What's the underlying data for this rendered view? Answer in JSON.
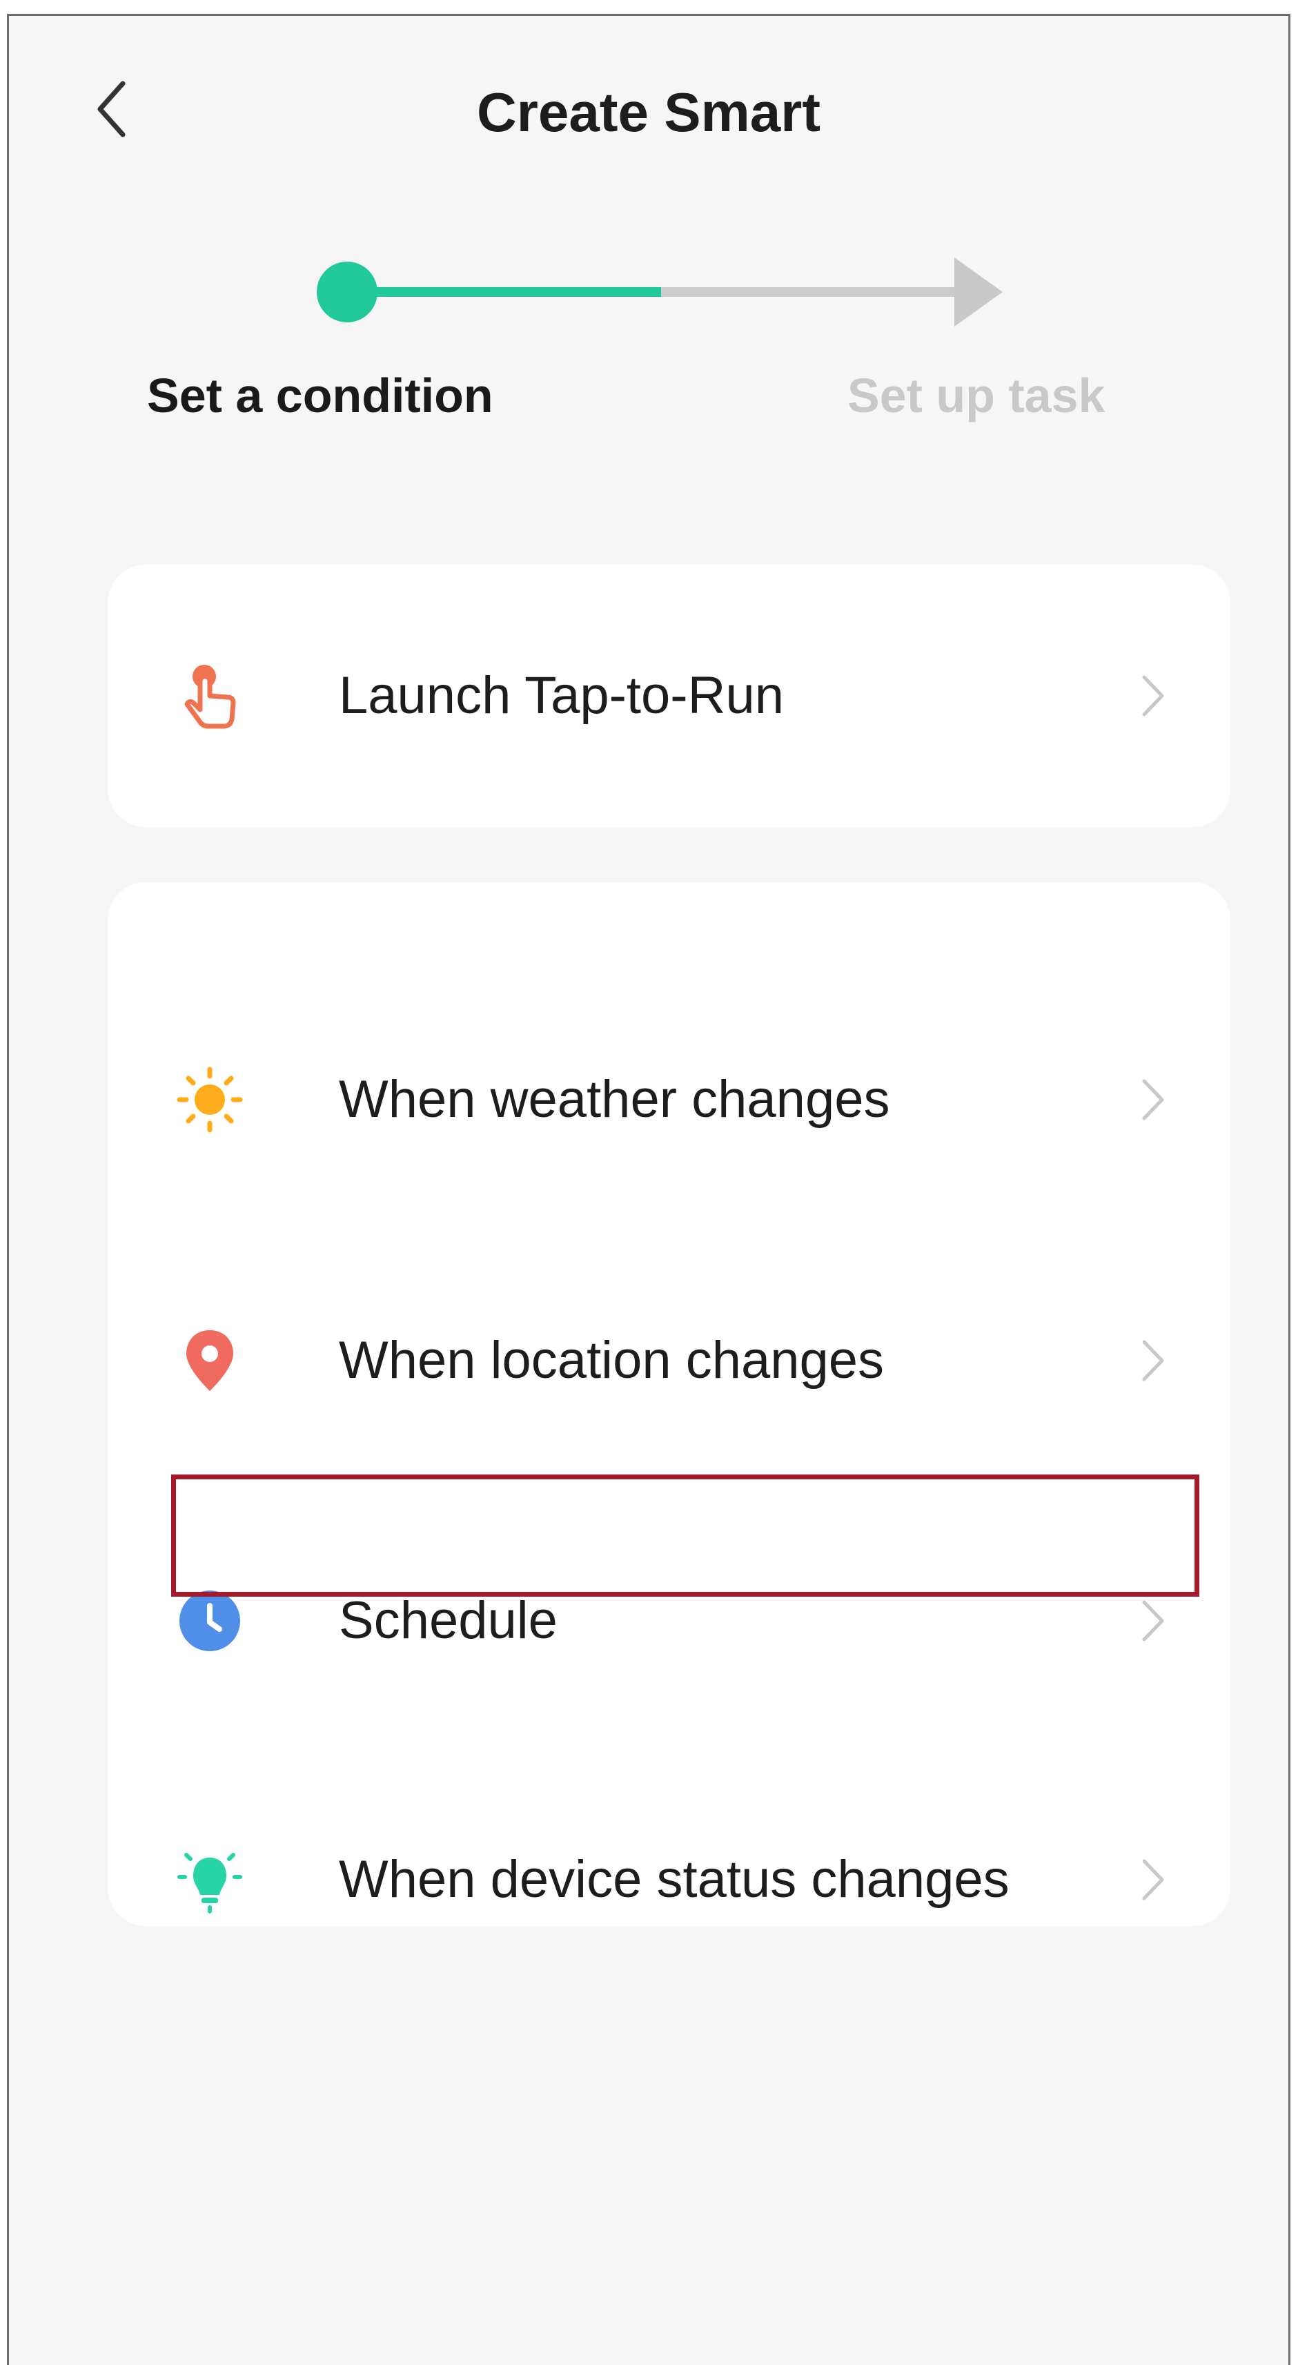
{
  "header": {
    "title": "Create Smart",
    "back_icon": "chevron-left-icon"
  },
  "stepper": {
    "steps": [
      {
        "label": "Set a condition",
        "state": "active"
      },
      {
        "label": "Set up task",
        "state": "inactive"
      }
    ],
    "progress": 0.5,
    "active_color": "#20c997",
    "inactive_color": "#c9c9c9"
  },
  "tap_to_run": {
    "label": "Launch Tap-to-Run",
    "icon": "tap-hand-icon",
    "icon_color": "#f07350"
  },
  "conditions": [
    {
      "label": "When weather changes",
      "icon": "sun-icon",
      "icon_color": "#ffac1c"
    },
    {
      "label": "When location changes",
      "icon": "location-pin-icon",
      "icon_color": "#ef6a5f"
    },
    {
      "label": "Schedule",
      "icon": "clock-icon",
      "icon_color": "#4f8fe8",
      "highlighted": true
    },
    {
      "label": "When device status changes",
      "icon": "device-bulb-icon",
      "icon_color": "#27d4a5"
    }
  ],
  "highlight_color": "#a31a2a"
}
